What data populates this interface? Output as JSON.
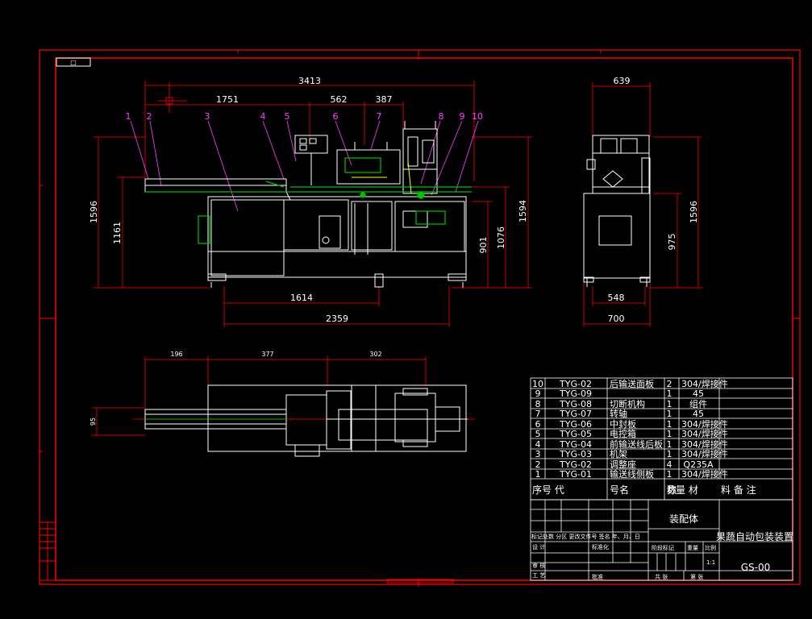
{
  "top_tag": "□",
  "front_view": {
    "dims": {
      "overall_width": "3413",
      "d1751": "1751",
      "d562": "562",
      "d387": "387",
      "height_left": "1596",
      "height_1161": "1161",
      "height_901": "901",
      "height_1076": "1076",
      "height_right": "1594",
      "bottom_1614": "1614",
      "bottom_2359": "2359"
    },
    "part_labels": [
      "1",
      "2",
      "3",
      "4",
      "5",
      "6",
      "7",
      "8",
      "9",
      "10"
    ]
  },
  "side_view": {
    "dims": {
      "top_width": "639",
      "height_1596": "1596",
      "height_975": "975",
      "width_548": "548",
      "width_700": "700"
    }
  },
  "plan_view": {
    "dims": {
      "d196": "196",
      "d377": "377",
      "d302": "302",
      "d95": "95"
    }
  },
  "bom": {
    "rows": [
      {
        "no": "10",
        "code": "TYG-02",
        "name": "后输送面板",
        "qty": "2",
        "material": "304/焊接件"
      },
      {
        "no": "9",
        "code": "TYG-09",
        "name": "",
        "qty": "1",
        "material": "45"
      },
      {
        "no": "8",
        "code": "TYG-08",
        "name": "切断机构",
        "qty": "1",
        "material": "组件"
      },
      {
        "no": "7",
        "code": "TYG-07",
        "name": "转轴",
        "qty": "1",
        "material": "45"
      },
      {
        "no": "6",
        "code": "TYG-06",
        "name": "中封板",
        "qty": "1",
        "material": "304/焊接件"
      },
      {
        "no": "5",
        "code": "TYG-05",
        "name": "电控箱",
        "qty": "1",
        "material": "304/焊接件"
      },
      {
        "no": "4",
        "code": "TYG-04",
        "name": "前输送线后板",
        "qty": "1",
        "material": "304/焊接件"
      },
      {
        "no": "3",
        "code": "TYG-03",
        "name": "机架",
        "qty": "1",
        "material": "304/焊接件"
      },
      {
        "no": "2",
        "code": "TYG-02",
        "name": "调整座",
        "qty": "4",
        "material": "Q235A"
      },
      {
        "no": "1",
        "code": "TYG-01",
        "name": "输送线侧板",
        "qty": "1",
        "material": "304/焊接件"
      }
    ],
    "header": {
      "no_code": "序号 代",
      "name": "号名",
      "qty": "称",
      "qty2": "数",
      "material": "量 材",
      "remark": "料  备  注"
    }
  },
  "title_block": {
    "assembly": "装配体",
    "product": "果蔬自动包装装置",
    "drawing_no": "GS-00",
    "row_mark": "标记处数  分区 更改文件号 签名  年、月、日",
    "design": "设 计",
    "standard": "标准化",
    "stage": "阶段标记",
    "weight": "重量",
    "scale": "比例",
    "scale_val": "1:1",
    "check": "审 核",
    "craft": "工 艺",
    "approve": "批准",
    "sheets": "共    张",
    "sheet": "第    张"
  },
  "colors": {
    "frame": "#ff0000",
    "outline": "#ffffff",
    "dims": "#ff0000",
    "label": "#ff40ff",
    "green": "#00c000",
    "yellow": "#ffff00"
  }
}
